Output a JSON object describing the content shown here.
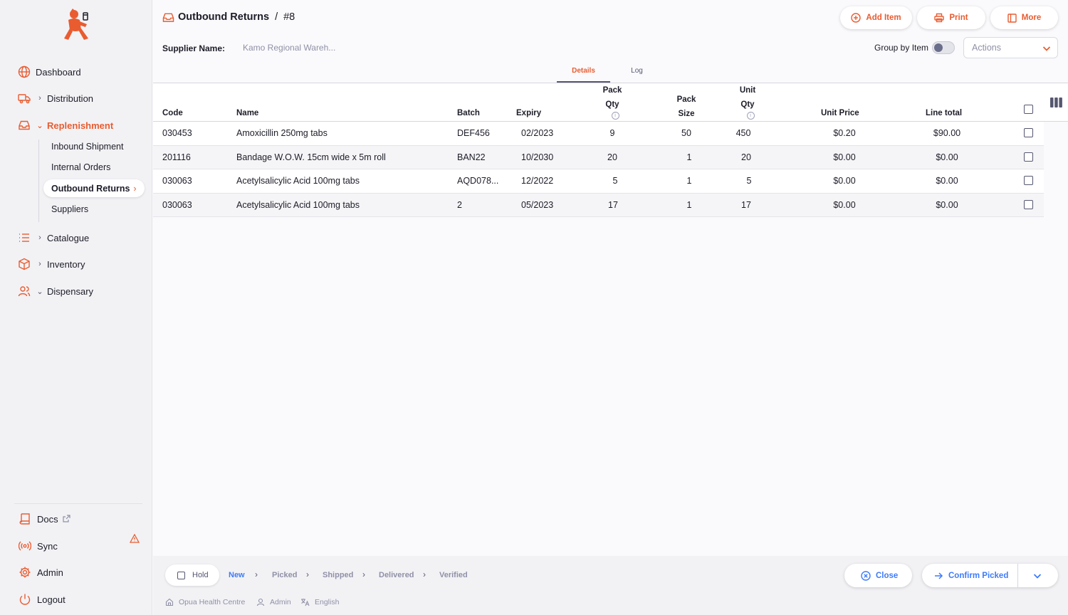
{
  "colors": {
    "accent": "#e95c30",
    "blue": "#3e7bfa",
    "muted": "#8f90a6"
  },
  "sidebar": {
    "items": [
      {
        "label": "Dashboard",
        "icon": "globe-icon"
      },
      {
        "label": "Distribution",
        "icon": "truck-icon"
      },
      {
        "label": "Replenishment",
        "icon": "inbox-icon"
      },
      {
        "label": "Catalogue",
        "icon": "list-icon"
      },
      {
        "label": "Inventory",
        "icon": "box-icon"
      },
      {
        "label": "Dispensary",
        "icon": "users-icon"
      }
    ],
    "sub_items": [
      "Inbound Shipment",
      "Internal Orders",
      "Outbound Returns",
      "Suppliers"
    ],
    "bottom": [
      {
        "label": "Docs",
        "icon": "book-icon"
      },
      {
        "label": "Sync",
        "icon": "radio-icon"
      },
      {
        "label": "Admin",
        "icon": "gear-icon"
      },
      {
        "label": "Logout",
        "icon": "power-icon"
      }
    ]
  },
  "header": {
    "title": "Outbound Returns",
    "separator": "/",
    "number": "#8",
    "buttons": {
      "add_item": "Add Item",
      "print": "Print",
      "more": "More"
    },
    "supplier_label": "Supplier Name:",
    "supplier_value": "Kamo Regional Wareh...",
    "group_by_label": "Group by Item",
    "group_by_on": false,
    "actions_placeholder": "Actions"
  },
  "tabs": [
    "Details",
    "Log"
  ],
  "table": {
    "headers": {
      "code": "Code",
      "name": "Name",
      "batch": "Batch",
      "expiry": "Expiry",
      "pack_qty_1": "Pack",
      "pack_qty_2": "Qty",
      "pack_size_1": "Pack",
      "pack_size_2": "Size",
      "unit_qty_1": "Unit",
      "unit_qty_2": "Qty",
      "unit_price": "Unit Price",
      "line_total": "Line total"
    },
    "rows": [
      {
        "code": "030453",
        "name": "Amoxicillin 250mg tabs",
        "batch": "DEF456",
        "expiry": "02/2023",
        "pack_qty": "9",
        "pack_size": "50",
        "unit_qty": "450",
        "unit_price": "$0.20",
        "line_total": "$90.00"
      },
      {
        "code": "201116",
        "name": "Bandage W.O.W. 15cm wide x 5m roll",
        "batch": "BAN22",
        "expiry": "10/2030",
        "pack_qty": "20",
        "pack_size": "1",
        "unit_qty": "20",
        "unit_price": "$0.00",
        "line_total": "$0.00"
      },
      {
        "code": "030063",
        "name": "Acetylsalicylic Acid 100mg tabs",
        "batch": "AQD078...",
        "expiry": "12/2022",
        "pack_qty": "5",
        "pack_size": "1",
        "unit_qty": "5",
        "unit_price": "$0.00",
        "line_total": "$0.00"
      },
      {
        "code": "030063",
        "name": "Acetylsalicylic Acid 100mg tabs",
        "batch": "2",
        "expiry": "05/2023",
        "pack_qty": "17",
        "pack_size": "1",
        "unit_qty": "17",
        "unit_price": "$0.00",
        "line_total": "$0.00"
      }
    ]
  },
  "footer": {
    "hold_label": "Hold",
    "statuses": [
      "New",
      "Picked",
      "Shipped",
      "Delivered",
      "Verified"
    ],
    "current_status": "New",
    "close_label": "Close",
    "confirm_label": "Confirm Picked",
    "store": "Opua Health Centre",
    "user": "Admin",
    "language": "English"
  }
}
